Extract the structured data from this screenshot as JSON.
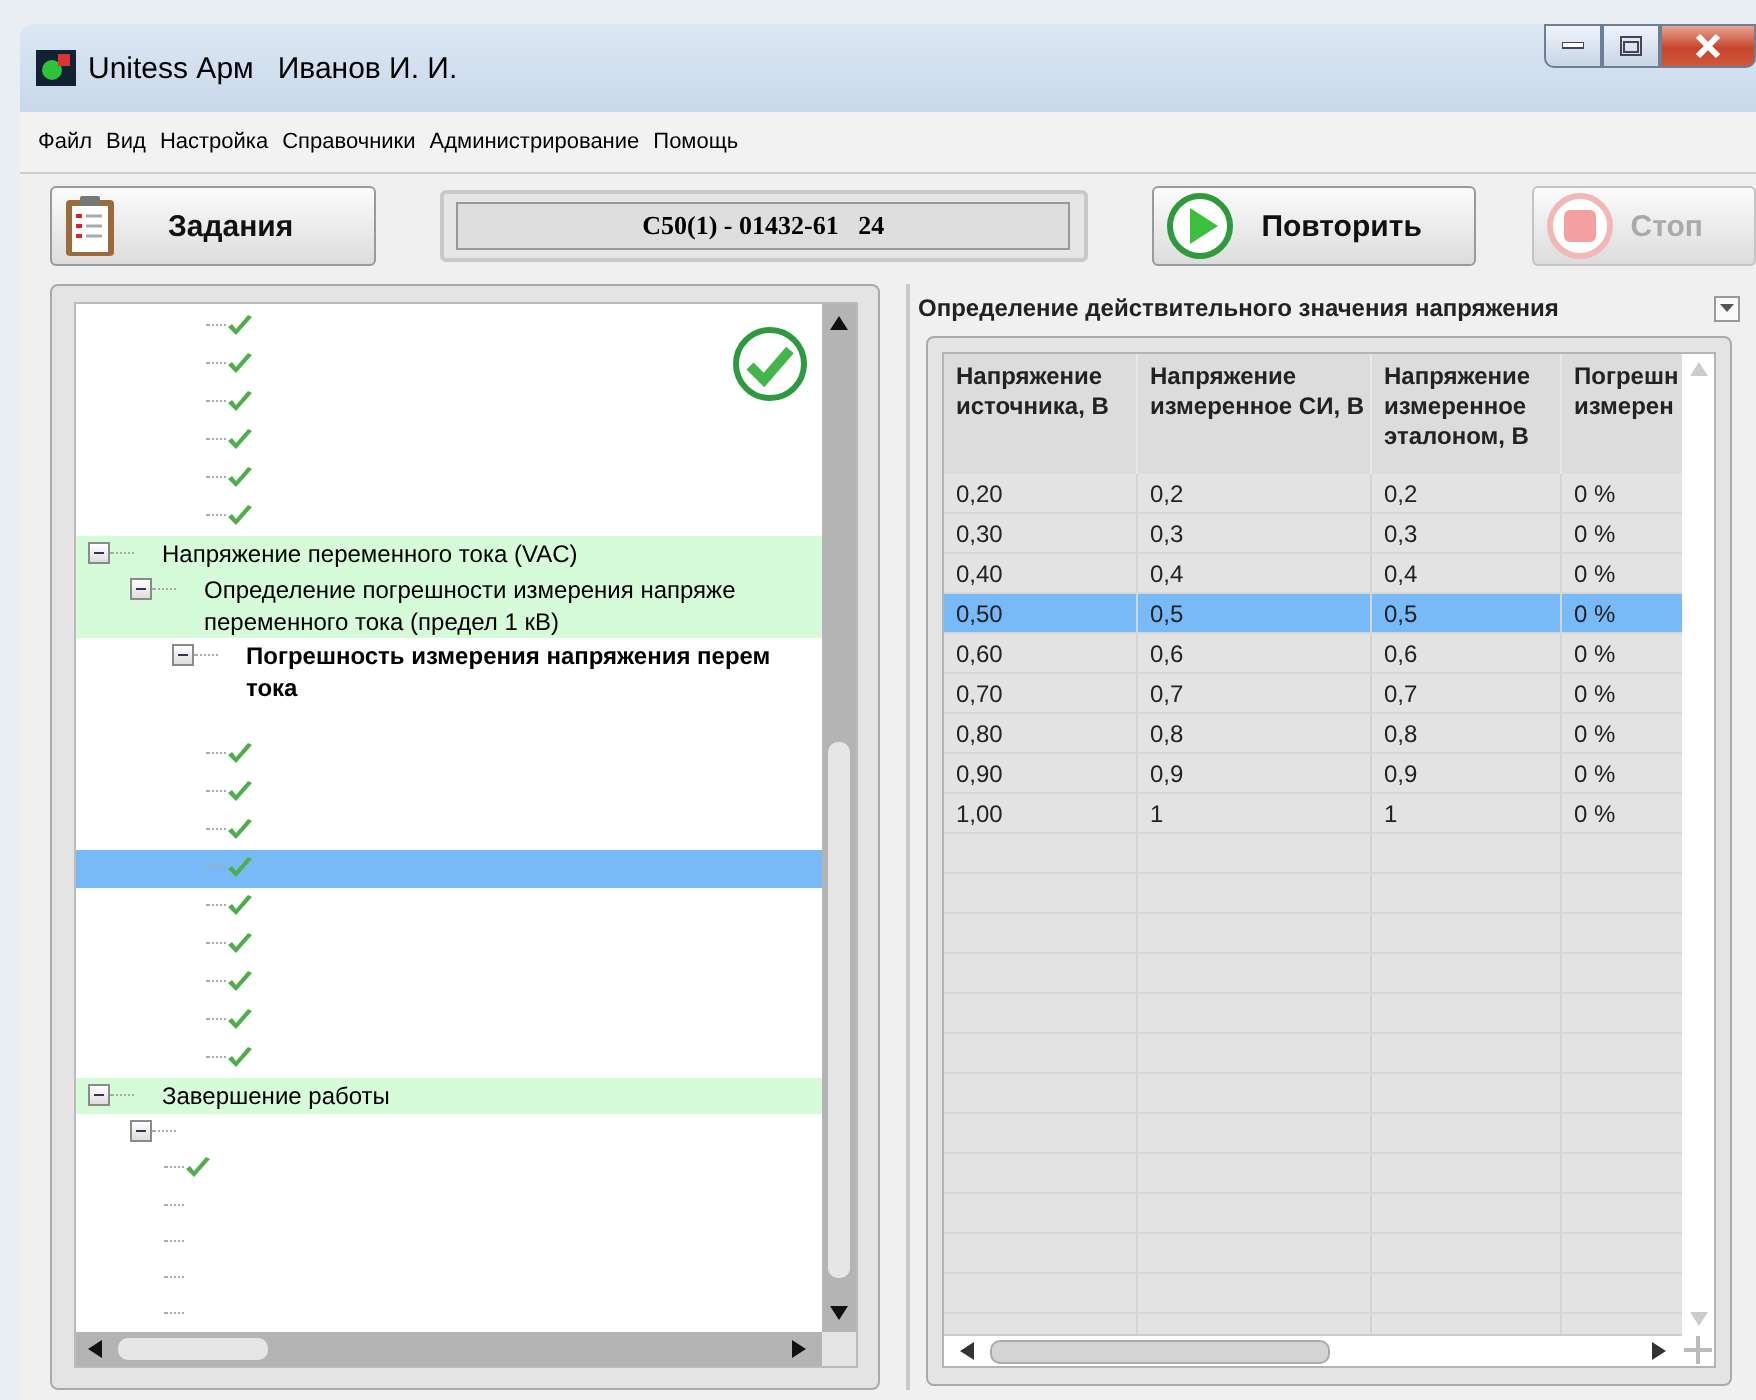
{
  "window": {
    "title": "Unitess Арм",
    "user": "Иванов И. И."
  },
  "menu": [
    "Файл",
    "Вид",
    "Настройка",
    "Справочники",
    "Администрирование",
    "Помощь"
  ],
  "toolbar": {
    "tasks_button": "Задания",
    "task_field": "C50(1) - 01432-61   24",
    "repeat_button": {
      "label": "Повторить",
      "disabled": false
    },
    "stop_button": {
      "label": "Стоп",
      "disabled": true
    }
  },
  "tree": {
    "items": [
      {
        "kind": "continued",
        "children": [
          {
            "kind": "continued",
            "children": [
              {
                "kind": "continued",
                "children": [
                  {
                    "kind": "check",
                    "selected": false
                  },
                  {
                    "kind": "check",
                    "selected": false
                  },
                  {
                    "kind": "check",
                    "selected": false
                  },
                  {
                    "kind": "check",
                    "selected": false
                  },
                  {
                    "kind": "check",
                    "selected": false
                  },
                  {
                    "kind": "check",
                    "selected": false
                  }
                ]
              }
            ]
          }
        ]
      },
      {
        "kind": "group",
        "label": "Напряжение переменного тока (VAC)",
        "expanded": true,
        "highlighted": true,
        "children": [
          {
            "kind": "group",
            "label": "Определение погрешности измерения напряже переменного тока (предел 1 кВ)",
            "expanded": true,
            "highlighted": true,
            "children": [
              {
                "kind": "test",
                "label": "Погрешность измерения напряжения перем тока",
                "expanded": true,
                "highlighted": false,
                "children": [
                  {
                    "kind": "check",
                    "selected": false
                  },
                  {
                    "kind": "check",
                    "selected": false
                  },
                  {
                    "kind": "check",
                    "selected": false
                  },
                  {
                    "kind": "check",
                    "selected": true
                  },
                  {
                    "kind": "check",
                    "selected": false
                  },
                  {
                    "kind": "check",
                    "selected": false
                  },
                  {
                    "kind": "check",
                    "selected": false
                  },
                  {
                    "kind": "check",
                    "selected": false
                  },
                  {
                    "kind": "check",
                    "selected": false
                  }
                ]
              }
            ]
          }
        ]
      },
      {
        "kind": "group",
        "label": "Завершение работы",
        "expanded": true,
        "highlighted": true,
        "children": [
          {
            "kind": "group",
            "expanded": true,
            "highlighted": false,
            "children": [
              {
                "kind": "check",
                "selected": false
              },
              {
                "kind": "empty",
                "selected": false
              },
              {
                "kind": "empty",
                "selected": false
              },
              {
                "kind": "empty",
                "selected": false
              },
              {
                "kind": "empty",
                "selected": false
              }
            ]
          }
        ]
      }
    ]
  },
  "section": {
    "title": "Определение действительного значения напряжения"
  },
  "table": {
    "columns": [
      "Напряжение источника, В",
      "Напряжение измеренное СИ, В",
      "Напряжение измеренное эталоном, В",
      "Погрешн измерен"
    ],
    "rows": [
      {
        "cells": [
          "0,20",
          "0,2",
          "0,2",
          "0 %"
        ],
        "selected": false
      },
      {
        "cells": [
          "0,30",
          "0,3",
          "0,3",
          "0 %"
        ],
        "selected": false
      },
      {
        "cells": [
          "0,40",
          "0,4",
          "0,4",
          "0 %"
        ],
        "selected": false
      },
      {
        "cells": [
          "0,50",
          "0,5",
          "0,5",
          "0 %"
        ],
        "selected": true
      },
      {
        "cells": [
          "0,60",
          "0,6",
          "0,6",
          "0 %"
        ],
        "selected": false
      },
      {
        "cells": [
          "0,70",
          "0,7",
          "0,7",
          "0 %"
        ],
        "selected": false
      },
      {
        "cells": [
          "0,80",
          "0,8",
          "0,8",
          "0 %"
        ],
        "selected": false
      },
      {
        "cells": [
          "0,90",
          "0,9",
          "0,9",
          "0 %"
        ],
        "selected": false
      },
      {
        "cells": [
          "1,00",
          "1",
          "1",
          "0 %"
        ],
        "selected": false
      }
    ]
  }
}
